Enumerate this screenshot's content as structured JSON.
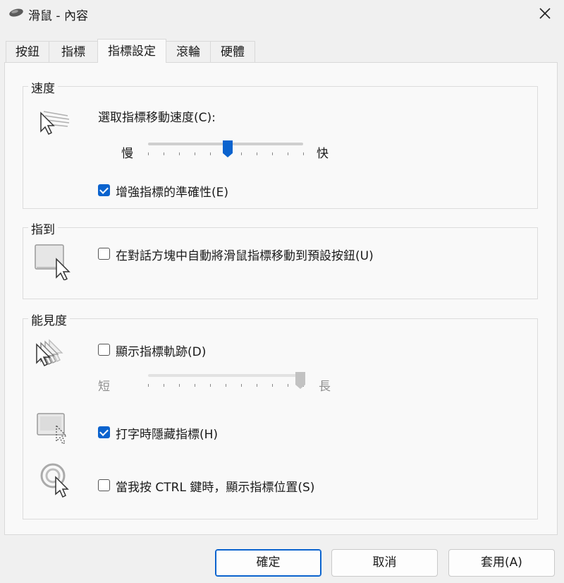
{
  "window": {
    "title": "滑鼠 - 內容"
  },
  "tabs": [
    {
      "label": "按鈕"
    },
    {
      "label": "指標"
    },
    {
      "label": "指標設定"
    },
    {
      "label": "滾輪"
    },
    {
      "label": "硬體"
    }
  ],
  "speed": {
    "title": "速度",
    "select_label": "選取指標移動速度(C):",
    "slow": "慢",
    "fast": "快",
    "value": 0.5,
    "enhance": {
      "label": "增強指標的準確性(E)",
      "checked": true
    }
  },
  "snap_to": {
    "title": "指到",
    "auto_move": {
      "label": "在對話方塊中自動將滑鼠指標移動到預設按鈕(U)",
      "checked": false
    }
  },
  "visibility": {
    "title": "能見度",
    "trails": {
      "label": "顯示指標軌跡(D)",
      "checked": false
    },
    "short": "短",
    "long": "長",
    "trail_value": 1.0,
    "hide_typing": {
      "label": "打字時隱藏指標(H)",
      "checked": true
    },
    "show_location": {
      "label": "當我按 CTRL 鍵時，顯示指標位置(S)",
      "checked": false
    }
  },
  "buttons": {
    "ok": "確定",
    "cancel": "取消",
    "apply": "套用(A)"
  },
  "colors": {
    "accent": "#0b63ce",
    "background": "#f0f0f0",
    "panel": "#f9f9f9"
  }
}
